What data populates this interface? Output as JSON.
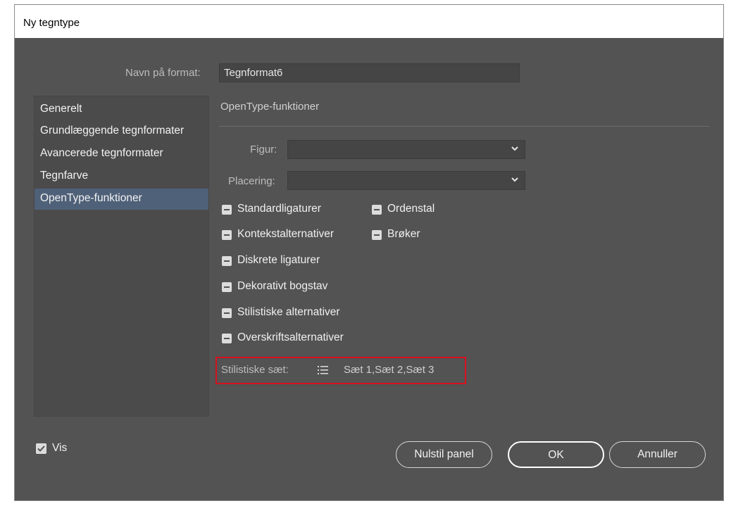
{
  "window": {
    "title": "Ny tegntype"
  },
  "name_field": {
    "label": "Navn på format:",
    "value": "Tegnformat6"
  },
  "sidebar": {
    "items": [
      {
        "label": "Generelt"
      },
      {
        "label": "Grundlæggende tegnformater"
      },
      {
        "label": "Avancerede tegnformater"
      },
      {
        "label": "Tegnfarve"
      },
      {
        "label": "OpenType-funktioner",
        "selected": true
      }
    ]
  },
  "panel": {
    "title": "OpenType-funktioner",
    "figur": {
      "label": "Figur:",
      "value": ""
    },
    "placering": {
      "label": "Placering:",
      "value": ""
    },
    "checkboxes": [
      {
        "label": "Standardligaturer",
        "state": "mixed"
      },
      {
        "label": "Ordenstal",
        "state": "mixed"
      },
      {
        "label": "Kontekstalternativer",
        "state": "mixed"
      },
      {
        "label": "Brøker",
        "state": "mixed"
      },
      {
        "label": "Diskrete ligaturer",
        "state": "mixed"
      },
      {
        "label": "Dekorativt bogstav",
        "state": "mixed"
      },
      {
        "label": "Stilistiske alternativer",
        "state": "mixed"
      },
      {
        "label": "Overskriftsalternativer",
        "state": "mixed"
      }
    ],
    "stylistic_sets": {
      "label": "Stilistiske sæt:",
      "icon": "list-icon",
      "value": "Sæt 1,Sæt 2,Sæt 3"
    }
  },
  "footer": {
    "preview": {
      "label": "Vis",
      "checked": true
    },
    "reset_label": "Nulstil panel",
    "ok_label": "OK",
    "cancel_label": "Annuller"
  },
  "colors": {
    "dialog_bg": "#535353",
    "selection": "#4f6179",
    "highlight_border": "#d8101e"
  }
}
